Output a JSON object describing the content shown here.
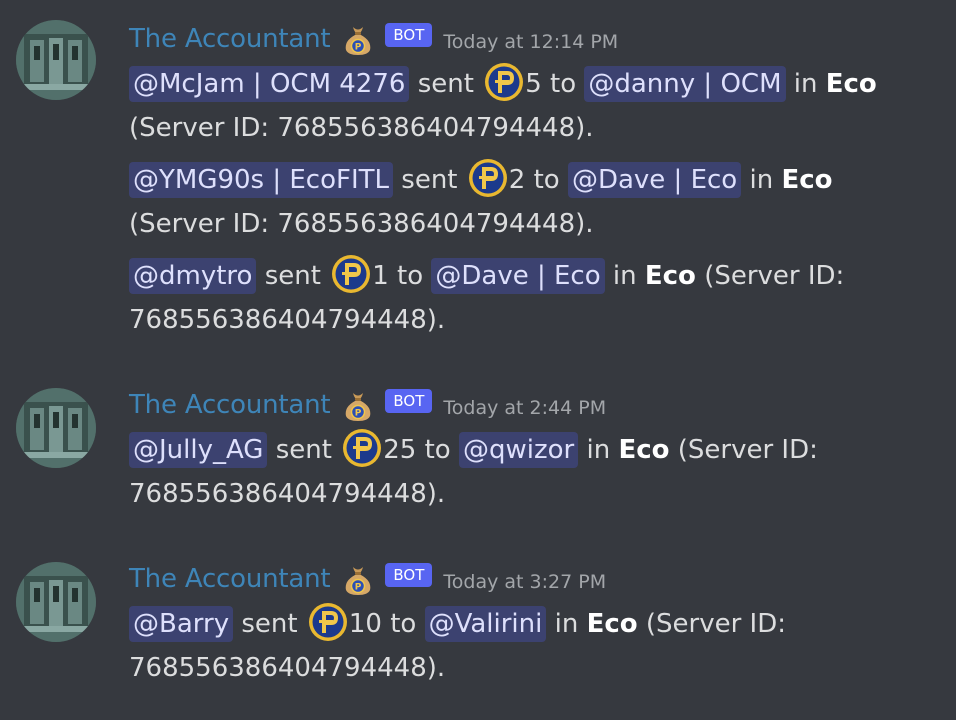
{
  "bot": {
    "username": "The Accountant",
    "tag": "BOT"
  },
  "messages": [
    {
      "timestamp": "Today at 12:14 PM",
      "lines": [
        {
          "sender": "@McJam | OCM 4276",
          "word_sent": "sent",
          "amount": "5",
          "word_to": "to",
          "recipient": "@danny | OCM",
          "word_in": "in",
          "server": "Eco",
          "line1_tail": "",
          "line2": "(Server ID: 768556386404794448)."
        },
        {
          "sender": "@YMG90s | EcoFITL",
          "word_sent": "sent",
          "amount": "2",
          "word_to": "to",
          "recipient": "@Dave | Eco",
          "word_in": "in",
          "server": "Eco",
          "line1_tail": "",
          "line2": "(Server ID: 768556386404794448)."
        },
        {
          "sender": "@dmytro",
          "word_sent": "sent",
          "amount": "1",
          "word_to": "to",
          "recipient": "@Dave | Eco",
          "word_in": "in",
          "server": "Eco",
          "line1_tail": "(Server ID:",
          "line2": "768556386404794448)."
        }
      ]
    },
    {
      "timestamp": "Today at 2:44 PM",
      "lines": [
        {
          "sender": "@Jully_AG",
          "word_sent": "sent",
          "amount": "25",
          "word_to": "to",
          "recipient": "@qwizor",
          "word_in": "in",
          "server": "Eco",
          "line1_tail": "(Server ID:",
          "line2": "768556386404794448)."
        }
      ]
    },
    {
      "timestamp": "Today at 3:27 PM",
      "lines": [
        {
          "sender": "@Barry",
          "word_sent": "sent",
          "amount": "10",
          "word_to": "to",
          "recipient": "@Valirini",
          "word_in": "in",
          "server": "Eco",
          "line1_tail": "(Server ID:",
          "line2": "768556386404794448)."
        }
      ]
    }
  ],
  "icons": {
    "avatar": "avatar-icon",
    "badge": "money-bag-icon",
    "currency": "coin-p-icon"
  },
  "colors": {
    "background": "#36393f",
    "username": "#3e85b8",
    "bot_tag": "#5865f2",
    "mention_bg": "#3c4270",
    "mention_text": "#dee0fc",
    "coin_fill": "#1c3a8c",
    "coin_ring": "#e9b830"
  }
}
